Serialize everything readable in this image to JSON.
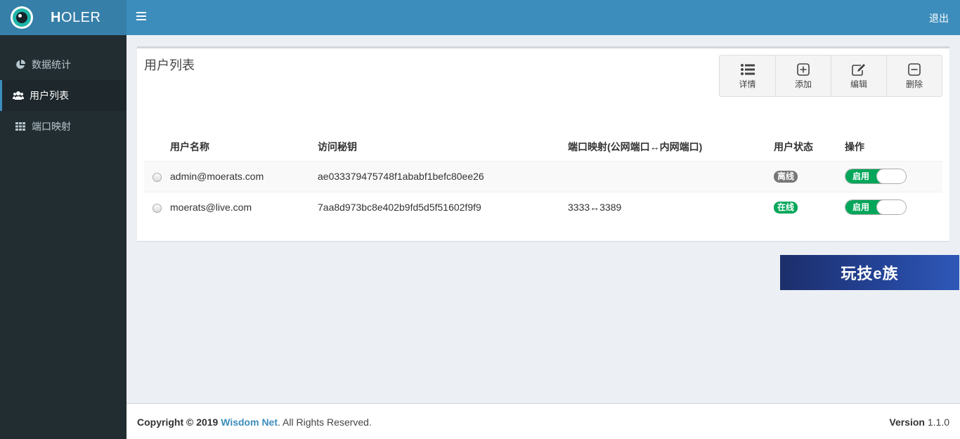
{
  "app": {
    "logo_bold": "H",
    "logo_rest": "OLER",
    "logout_label": "退出"
  },
  "sidebar": {
    "items": [
      {
        "label": "数据统计",
        "icon": "pie-chart-icon"
      },
      {
        "label": "用户列表",
        "icon": "users-icon",
        "active": true
      },
      {
        "label": "端口映射",
        "icon": "grid-icon"
      }
    ]
  },
  "main": {
    "title": "用户列表",
    "toolbar": [
      {
        "label": "详情",
        "icon": "list-icon"
      },
      {
        "label": "添加",
        "icon": "plus-square-icon"
      },
      {
        "label": "编辑",
        "icon": "edit-icon"
      },
      {
        "label": "删除",
        "icon": "minus-square-icon"
      }
    ],
    "table": {
      "columns": [
        "用户名称",
        "访问秘钥",
        "端口映射(公网端口↔内网端口)",
        "用户状态",
        "操作"
      ],
      "rows": [
        {
          "name": "admin@moerats.com",
          "key": "ae033379475748f1ababf1befc80ee26",
          "ports": "",
          "status": "离线",
          "status_color": "#777777",
          "toggle": "启用"
        },
        {
          "name": "moerats@live.com",
          "key": "7aa8d973bc8e402b9fd5d5f51602f9f9",
          "ports": "3333↔3389",
          "status": "在线",
          "status_color": "#00a65a",
          "toggle": "启用"
        }
      ]
    }
  },
  "banner": {
    "text": "玩技e族"
  },
  "footer": {
    "copyright_prefix": "Copyright © 2019",
    "company": "Wisdom Net",
    "copyright_suffix": ". All Rights Reserved.",
    "version_label": "Version",
    "version_value": "1.1.0"
  },
  "colors": {
    "header": "#3c8dbc",
    "logo_bar": "#367fa9",
    "sidebar": "#222d32",
    "success": "#00a65a"
  }
}
